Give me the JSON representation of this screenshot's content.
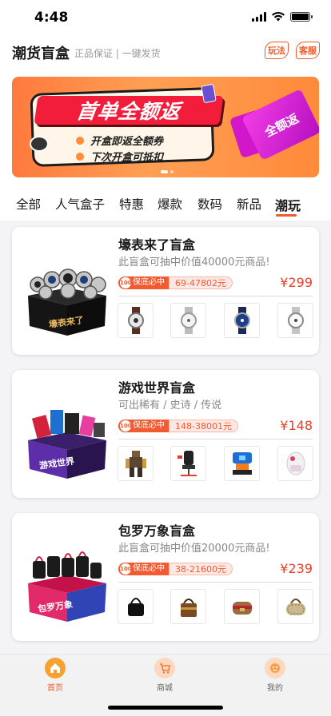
{
  "status": {
    "time": "4:48"
  },
  "header": {
    "title": "潮货盲盒",
    "subtitle": "正品保证 | 一键发货",
    "rules_label": "玩法",
    "service_label": "客服"
  },
  "banner": {
    "title": "首单全额返",
    "line1": "开盒即返全额券",
    "line2": "下次开盒可抵扣",
    "ticket_text": "全额返"
  },
  "tabs": [
    "全部",
    "人气盒子",
    "特惠",
    "爆款",
    "数码",
    "新品",
    "潮玩"
  ],
  "active_tab": "潮玩",
  "accent_color": "#ef5a2a",
  "price_color": "#e8402b",
  "cards": [
    {
      "title": "壕表来了盲盒",
      "desc": "此盲盒可抽中价值40000元商品!",
      "badge_pct": "100%",
      "badge": "保底必中",
      "range": "69-47802元",
      "price": "¥299",
      "box_label": "壕表来了",
      "thumbs": [
        "watch-icon",
        "watch-icon",
        "watch-icon",
        "watch-icon"
      ]
    },
    {
      "title": "游戏世界盲盒",
      "desc": "可出稀有 / 史诗 / 传说",
      "badge_pct": "100%",
      "badge": "保底必中",
      "range": "148-38001元",
      "price": "¥148",
      "box_label": "游戏世界",
      "thumbs": [
        "robot-figure-icon",
        "gaming-chair-icon",
        "racing-seat-icon",
        "console-controller-icon"
      ]
    },
    {
      "title": "包罗万象盲盒",
      "desc": "此盲盒可抽中价值20000元商品!",
      "badge_pct": "100%",
      "badge": "保底必中",
      "range": "38-21600元",
      "price": "¥239",
      "box_label": "包罗万象",
      "thumbs": [
        "handbag-icon",
        "handbag-icon",
        "handbag-icon",
        "handbag-icon"
      ]
    }
  ],
  "nav": [
    {
      "label": "首页",
      "icon": "home-icon"
    },
    {
      "label": "商城",
      "icon": "cart-icon"
    },
    {
      "label": "我的",
      "icon": "profile-icon"
    }
  ]
}
